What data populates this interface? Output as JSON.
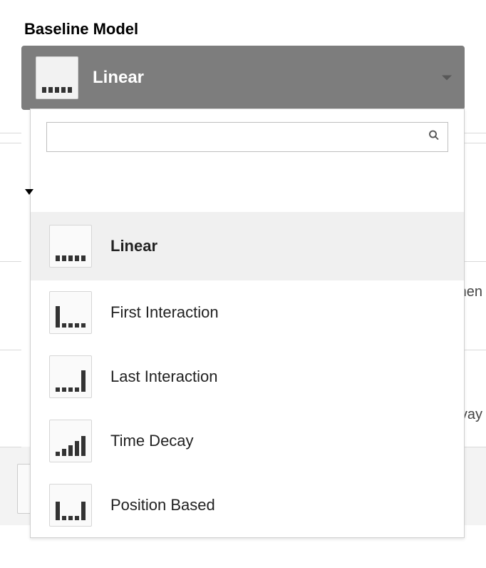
{
  "label": "Baseline Model",
  "selected": {
    "label": "Linear",
    "icon": "linear"
  },
  "search": {
    "placeholder": ""
  },
  "options": [
    {
      "label": "Linear",
      "icon": "linear",
      "selected": true
    },
    {
      "label": "First Interaction",
      "icon": "first",
      "selected": false
    },
    {
      "label": "Last Interaction",
      "icon": "last",
      "selected": false
    },
    {
      "label": "Time Decay",
      "icon": "decay",
      "selected": false
    },
    {
      "label": "Position Based",
      "icon": "position",
      "selected": false
    }
  ],
  "bg_text": {
    "frag1": "nen",
    "frag2": "vay"
  }
}
